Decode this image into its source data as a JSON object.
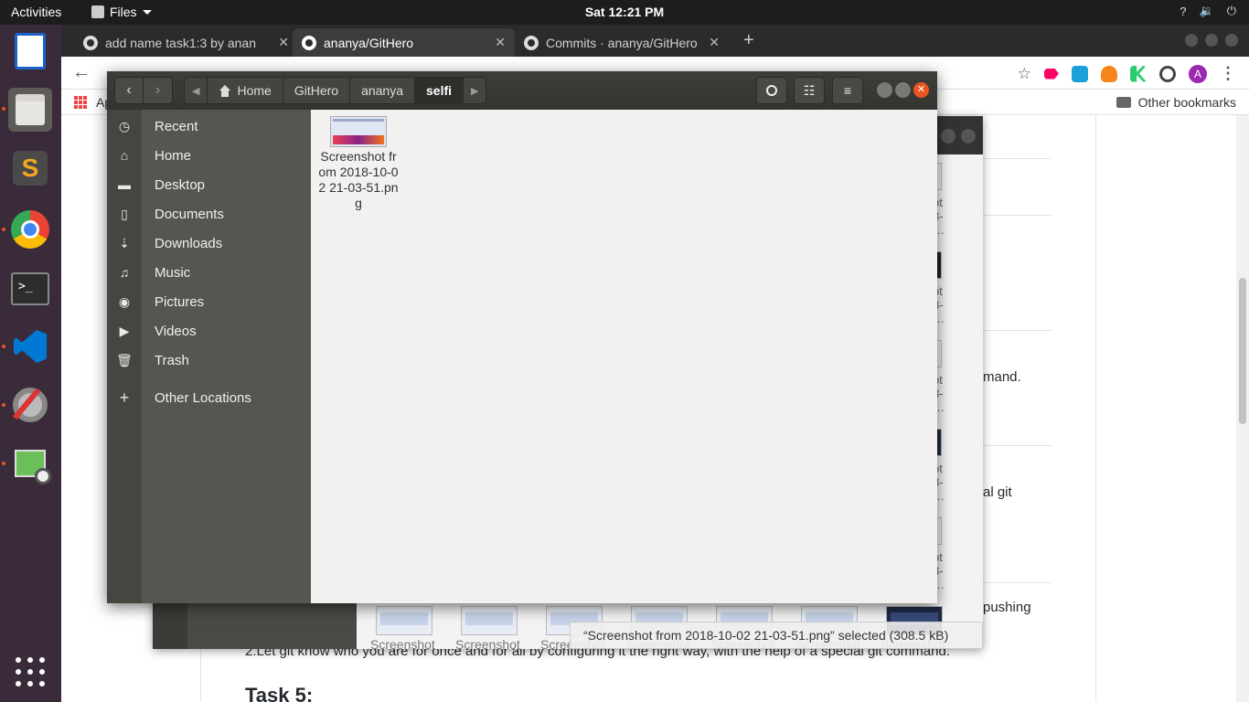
{
  "topbar": {
    "activities": "Activities",
    "app_menu": "Files",
    "clock": "Sat 12:21 PM",
    "tray": [
      "?",
      "🔉",
      "⏻"
    ]
  },
  "dock": {
    "items": [
      {
        "name": "writer-icon",
        "color": "#1c63c9"
      },
      {
        "name": "files-icon",
        "color": "#7a7a74"
      },
      {
        "name": "sublime-icon",
        "color": "#f5a623"
      },
      {
        "name": "chrome-icon",
        "color": "#4285f4"
      },
      {
        "name": "terminal-icon",
        "color": "#2d2d2d"
      },
      {
        "name": "vscode-icon",
        "color": "#0078d4"
      },
      {
        "name": "settings-icon",
        "color": "#c8c8c8"
      },
      {
        "name": "image-viewer-icon",
        "color": "#6bbf59"
      }
    ],
    "show_apps": "⋮⋮⋮"
  },
  "chrome": {
    "tabs": [
      {
        "title": "add name task1:3 by anan"
      },
      {
        "title": "ananya/GitHero"
      },
      {
        "title": "Commits · ananya/GitHero"
      }
    ],
    "new_tab": "+",
    "bookmarks": {
      "apps": "Ap",
      "other": "Other bookmarks"
    },
    "avatar_letter": "A"
  },
  "page": {
    "lines": [
      "mand.",
      "al git",
      "pushing",
      "2.Let git know who you are for once and for all by configuring it the right way, with the help of a special git command."
    ],
    "heading": "Task 5:"
  },
  "bg_dialog": {
    "thumb_labels": [
      "Screenshot",
      "Screenshot",
      "Screenshot",
      "Screenshot",
      "Screenshot",
      "Screenshot",
      "Screenshot"
    ],
    "right_labels": [
      "ot\n8-\n…",
      "ot\n8-\n…",
      "ot\n8-\n…",
      "ot\n8-\n…",
      "ot\n8-\n…"
    ],
    "status": "“Screenshot from 2018-10-02 21-03-51.png” selected (308.5 kB)"
  },
  "fm": {
    "crumbs": [
      "Home",
      "GitHero",
      "ananya",
      "selfi"
    ],
    "sidebar": [
      {
        "label": "Recent",
        "icon": "◷"
      },
      {
        "label": "Home",
        "icon": "⌂"
      },
      {
        "label": "Desktop",
        "icon": "▬"
      },
      {
        "label": "Documents",
        "icon": "▯"
      },
      {
        "label": "Downloads",
        "icon": "⇣"
      },
      {
        "label": "Music",
        "icon": "♫"
      },
      {
        "label": "Pictures",
        "icon": "◉"
      },
      {
        "label": "Videos",
        "icon": "▶"
      },
      {
        "label": "Trash",
        "icon": "🗑"
      },
      {
        "label": "Other Locations",
        "icon": "+"
      }
    ],
    "file": {
      "name": "Screenshot from 2018-10-02 21-03-51.png"
    }
  }
}
